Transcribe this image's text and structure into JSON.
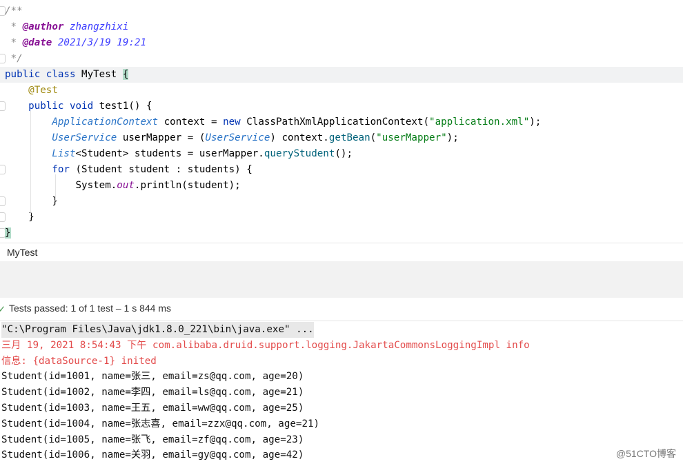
{
  "editor": {
    "lines": [
      {
        "segments": [
          {
            "t": "/**",
            "c": "cm"
          }
        ]
      },
      {
        "segments": [
          {
            "t": " * ",
            "c": "cm"
          },
          {
            "t": "@author",
            "c": "tag"
          },
          {
            "t": " zhangzhixi",
            "c": "cmv"
          }
        ]
      },
      {
        "segments": [
          {
            "t": " * ",
            "c": "cm"
          },
          {
            "t": "@date",
            "c": "tag"
          },
          {
            "t": " 2021/3/19 19:21",
            "c": "cmv"
          }
        ]
      },
      {
        "segments": [
          {
            "t": " */",
            "c": "cm"
          }
        ]
      },
      {
        "segments": [
          {
            "t": "public class ",
            "c": "kw"
          },
          {
            "t": "MyTest ",
            "c": "plain"
          },
          {
            "t": "{",
            "c": "brace"
          }
        ]
      },
      {
        "segments": [
          {
            "t": "    "
          },
          {
            "t": "@Test",
            "c": "ann"
          }
        ]
      },
      {
        "segments": [
          {
            "t": "    "
          },
          {
            "t": "public void ",
            "c": "kw"
          },
          {
            "t": "test1",
            "c": "plain"
          },
          {
            "t": "() {",
            "c": "plain"
          }
        ]
      },
      {
        "segments": [
          {
            "t": "        "
          },
          {
            "t": "ApplicationContext",
            "c": "iface"
          },
          {
            "t": " context = ",
            "c": "plain"
          },
          {
            "t": "new ",
            "c": "kw"
          },
          {
            "t": "ClassPathXmlApplicationContext(",
            "c": "plain"
          },
          {
            "t": "\"application.xml\"",
            "c": "str"
          },
          {
            "t": ");",
            "c": "plain"
          }
        ]
      },
      {
        "segments": [
          {
            "t": "        "
          },
          {
            "t": "UserService",
            "c": "iface"
          },
          {
            "t": " userMapper = (",
            "c": "plain"
          },
          {
            "t": "UserService",
            "c": "iface"
          },
          {
            "t": ") context.",
            "c": "plain"
          },
          {
            "t": "getBean",
            "c": "fn"
          },
          {
            "t": "(",
            "c": "plain"
          },
          {
            "t": "\"userMapper\"",
            "c": "str"
          },
          {
            "t": ");",
            "c": "plain"
          }
        ]
      },
      {
        "segments": [
          {
            "t": "        "
          },
          {
            "t": "List",
            "c": "iface"
          },
          {
            "t": "<Student> students = userMapper.",
            "c": "plain"
          },
          {
            "t": "queryStudent",
            "c": "fn"
          },
          {
            "t": "();",
            "c": "plain"
          }
        ]
      },
      {
        "segments": [
          {
            "t": "        "
          },
          {
            "t": "for ",
            "c": "kw"
          },
          {
            "t": "(Student student : students) {",
            "c": "plain"
          }
        ]
      },
      {
        "segments": [
          {
            "t": "            "
          },
          {
            "t": "System.",
            "c": "plain"
          },
          {
            "t": "out",
            "c": "static"
          },
          {
            "t": ".println(student);",
            "c": "plain"
          }
        ]
      },
      {
        "segments": [
          {
            "t": "        "
          },
          {
            "t": "}",
            "c": "plain"
          }
        ]
      },
      {
        "segments": [
          {
            "t": "    "
          },
          {
            "t": "}",
            "c": "plain"
          }
        ]
      },
      {
        "segments": [
          {
            "t": "}",
            "c": "brace"
          }
        ]
      }
    ]
  },
  "breadcrumb": {
    "label": "MyTest"
  },
  "test_status": {
    "icon": "check-icon",
    "text": "Tests passed: 1 of 1 test – 1 s 844 ms"
  },
  "console": {
    "lines": [
      {
        "text": "\"C:\\Program Files\\Java\\jdk1.8.0_221\\bin\\java.exe\" ...",
        "style": "cmd"
      },
      {
        "text": "三月 19, 2021 8:54:43 下午 com.alibaba.druid.support.logging.JakartaCommonsLoggingImpl info",
        "style": "red"
      },
      {
        "text": "信息: {dataSource-1} inited",
        "style": "red"
      },
      {
        "text": "Student(id=1001, name=张三, email=zs@qq.com, age=20)",
        "style": "blk"
      },
      {
        "text": "Student(id=1002, name=李四, email=ls@qq.com, age=21)",
        "style": "blk"
      },
      {
        "text": "Student(id=1003, name=王五, email=ww@qq.com, age=25)",
        "style": "blk"
      },
      {
        "text": "Student(id=1004, name=张志喜, email=zzx@qq.com, age=21)",
        "style": "blk"
      },
      {
        "text": "Student(id=1005, name=张飞, email=zf@qq.com, age=23)",
        "style": "blk"
      },
      {
        "text": "Student(id=1006, name=关羽, email=gy@qq.com, age=42)",
        "style": "blk"
      }
    ]
  },
  "watermark": "@51CTO博客"
}
